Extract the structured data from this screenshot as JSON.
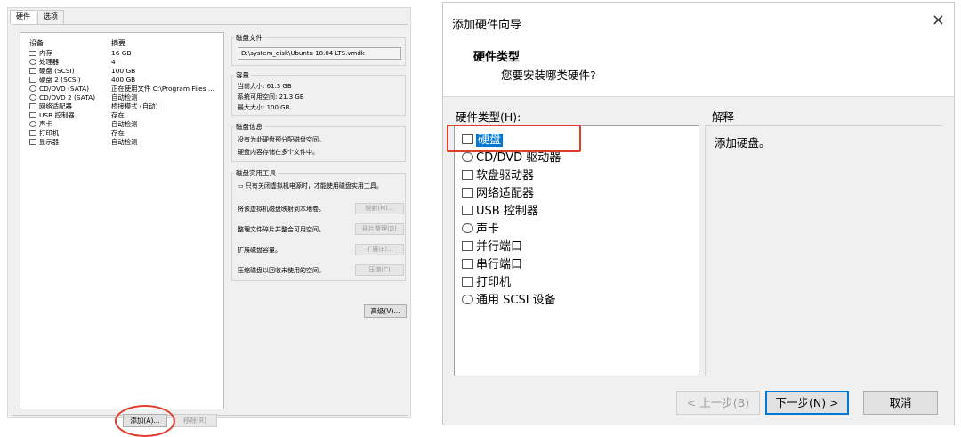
{
  "left": {
    "tabs": [
      {
        "label": "硬件"
      },
      {
        "label": "选项"
      }
    ],
    "device_header": "设备",
    "summary_header": "摘要",
    "devices": [
      {
        "name": "内存",
        "summary": "16 GB",
        "icon": "memory-icon"
      },
      {
        "name": "处理器",
        "summary": "4",
        "icon": "processor-icon"
      },
      {
        "name": "硬盘 (SCSI)",
        "summary": "100 GB",
        "icon": "harddisk-icon"
      },
      {
        "name": "硬盘 2 (SCSI)",
        "summary": "400 GB",
        "icon": "harddisk-icon"
      },
      {
        "name": "CD/DVD (SATA)",
        "summary": "正在使用文件 C:\\Program Files ...",
        "icon": "cd-icon"
      },
      {
        "name": "CD/DVD 2 (SATA)",
        "summary": "自动检测",
        "icon": "cd-icon"
      },
      {
        "name": "网络适配器",
        "summary": "桥接模式 (自动)",
        "icon": "network-icon"
      },
      {
        "name": "USB 控制器",
        "summary": "存在",
        "icon": "usb-icon"
      },
      {
        "name": "声卡",
        "summary": "自动检测",
        "icon": "sound-icon"
      },
      {
        "name": "打印机",
        "summary": "存在",
        "icon": "printer-icon"
      },
      {
        "name": "显示器",
        "summary": "自动检测",
        "icon": "display-icon"
      }
    ],
    "add_button": "添加(A)...",
    "remove_button": "移除(R)",
    "disk_file": {
      "title": "磁盘文件",
      "path": "D:\\system_disk\\Ubuntu 18.04 LTS.vmdk"
    },
    "capacity": {
      "title": "容量",
      "current": "当前大小: 61.3 GB",
      "available": "系统可用空间: 21.3 GB",
      "max": "最大大小: 100 GB"
    },
    "disk_info": {
      "title": "磁盘信息",
      "line1": "没有为此硬盘预分配磁盘空间。",
      "line2": "硬盘内容存储在多个文件中。"
    },
    "utilities": {
      "title": "磁盘实用工具",
      "note": "只有关闭虚拟机电源时，才能使用磁盘实用工具。",
      "rows": [
        {
          "text": "将该虚拟机磁盘映射到本地卷。",
          "button": "映射(M)..."
        },
        {
          "text": "整理文件碎片并整合可用空间。",
          "button": "碎片整理(D)"
        },
        {
          "text": "扩展磁盘容量。",
          "button": "扩展(E)..."
        },
        {
          "text": "压缩磁盘以回收未使用的空间。",
          "button": "压缩(C)"
        }
      ]
    },
    "advanced_button": "高级(V)..."
  },
  "wizard": {
    "title": "添加硬件向导",
    "close": "×",
    "header_title": "硬件类型",
    "header_subtitle": "您要安装哪类硬件?",
    "list_label": "硬件类型(H):",
    "items": [
      {
        "label": "硬盘",
        "icon": "harddisk-icon",
        "selected": true
      },
      {
        "label": "CD/DVD 驱动器",
        "icon": "cd-icon"
      },
      {
        "label": "软盘驱动器",
        "icon": "floppy-icon"
      },
      {
        "label": "网络适配器",
        "icon": "network-icon"
      },
      {
        "label": "USB 控制器",
        "icon": "usb-icon"
      },
      {
        "label": "声卡",
        "icon": "sound-icon"
      },
      {
        "label": "并行端口",
        "icon": "parallel-port-icon"
      },
      {
        "label": "串行端口",
        "icon": "serial-port-icon"
      },
      {
        "label": "打印机",
        "icon": "printer-icon"
      },
      {
        "label": "通用 SCSI 设备",
        "icon": "scsi-icon"
      }
    ],
    "explain_label": "解释",
    "explain_text": "添加硬盘。",
    "back_button": "< 上一步(B)",
    "next_button": "下一步(N) >",
    "cancel_button": "取消",
    "colors": {
      "selection": "#0078d7",
      "highlight": "#e23b2b"
    }
  }
}
